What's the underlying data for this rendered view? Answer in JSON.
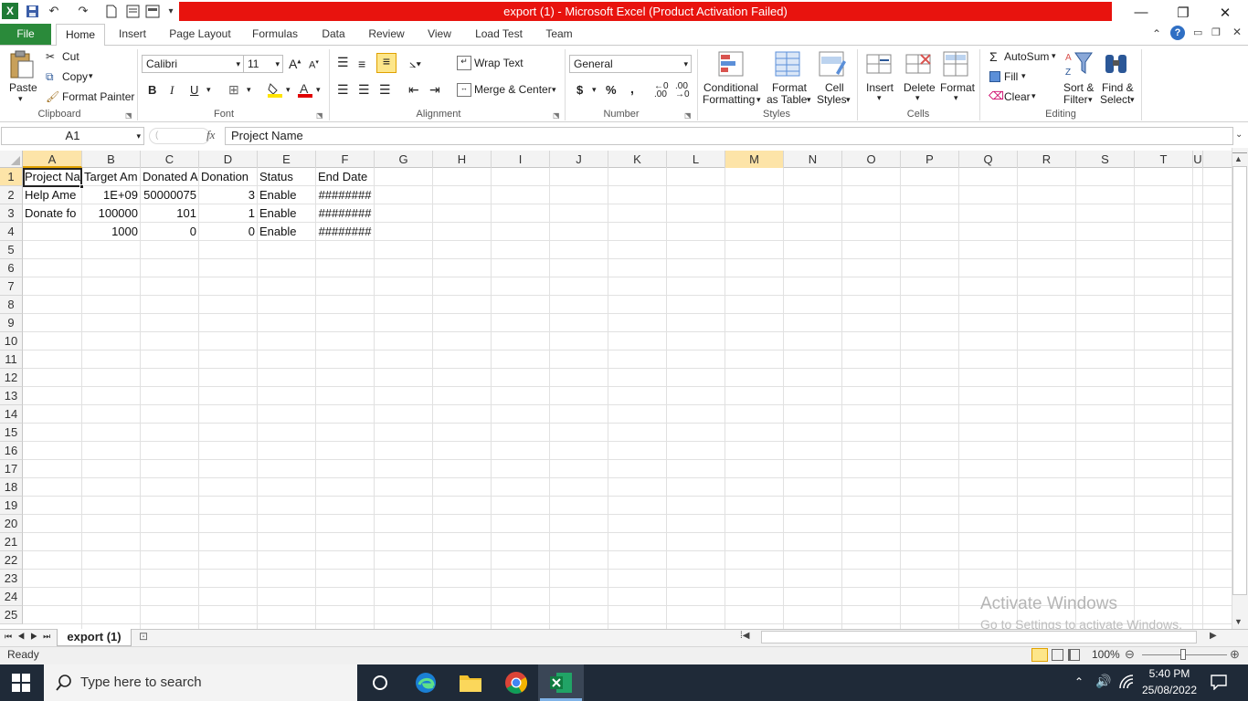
{
  "window": {
    "title": "export (1)  -  Microsoft Excel (Product Activation Failed)",
    "minimize": "—",
    "restore": "❐",
    "close": "✕"
  },
  "tabs": [
    "File",
    "Home",
    "Insert",
    "Page Layout",
    "Formulas",
    "Data",
    "Review",
    "View",
    "Load Test",
    "Team"
  ],
  "ribbon": {
    "clipboard": {
      "paste": "Paste",
      "cut": "Cut",
      "copy": "Copy",
      "format_painter": "Format Painter",
      "label": "Clipboard"
    },
    "font": {
      "name": "Calibri",
      "size": "11",
      "bold": "B",
      "italic": "I",
      "underline": "U",
      "label": "Font"
    },
    "alignment": {
      "wrap": "Wrap Text",
      "merge": "Merge & Center",
      "label": "Alignment"
    },
    "number": {
      "format": "General",
      "currency": "$",
      "percent": "%",
      "comma": ",",
      "label": "Number"
    },
    "styles": {
      "conditional": "Conditional",
      "conditional2": "Formatting",
      "format_table": "Format",
      "format_table2": "as Table",
      "cell_styles": "Cell",
      "cell_styles2": "Styles",
      "label": "Styles"
    },
    "cells": {
      "insert": "Insert",
      "delete": "Delete",
      "format": "Format",
      "label": "Cells"
    },
    "editing": {
      "autosum": "AutoSum",
      "fill": "Fill",
      "clear": "Clear",
      "sort": "Sort &",
      "sort2": "Filter",
      "find": "Find &",
      "find2": "Select",
      "label": "Editing"
    }
  },
  "formula_bar": {
    "name_box": "A1",
    "fx": "fx",
    "content": "Project Name"
  },
  "columns": [
    "A",
    "B",
    "C",
    "D",
    "E",
    "F",
    "G",
    "H",
    "I",
    "J",
    "K",
    "L",
    "M",
    "N",
    "O",
    "P",
    "Q",
    "R",
    "S",
    "T",
    "U"
  ],
  "rows": [
    "1",
    "2",
    "3",
    "4",
    "5",
    "6",
    "7",
    "8",
    "9",
    "10",
    "11",
    "12",
    "13",
    "14",
    "15",
    "16",
    "17",
    "18",
    "19",
    "20",
    "21",
    "22",
    "23",
    "24",
    "25"
  ],
  "cells": {
    "r1": [
      "Project Na",
      "Target Am",
      "Donated A",
      "Donation",
      "Status",
      "End Date"
    ],
    "r2": [
      "Help Ame",
      "1E+09",
      "50000075",
      "3",
      "Enable",
      "########"
    ],
    "r3": [
      "Donate fo",
      "100000",
      "101",
      "1",
      "Enable",
      "########"
    ],
    "r4": [
      "",
      "1000",
      "0",
      "0",
      "Enable",
      "########"
    ]
  },
  "sheet_tab": "export (1)",
  "status": {
    "ready": "Ready",
    "zoom": "100%"
  },
  "watermark": {
    "line1": "Activate Windows",
    "line2": "Go to Settings to activate Windows."
  },
  "taskbar": {
    "search_placeholder": "Type here to search",
    "time": "5:40 PM",
    "date": "25/08/2022"
  }
}
